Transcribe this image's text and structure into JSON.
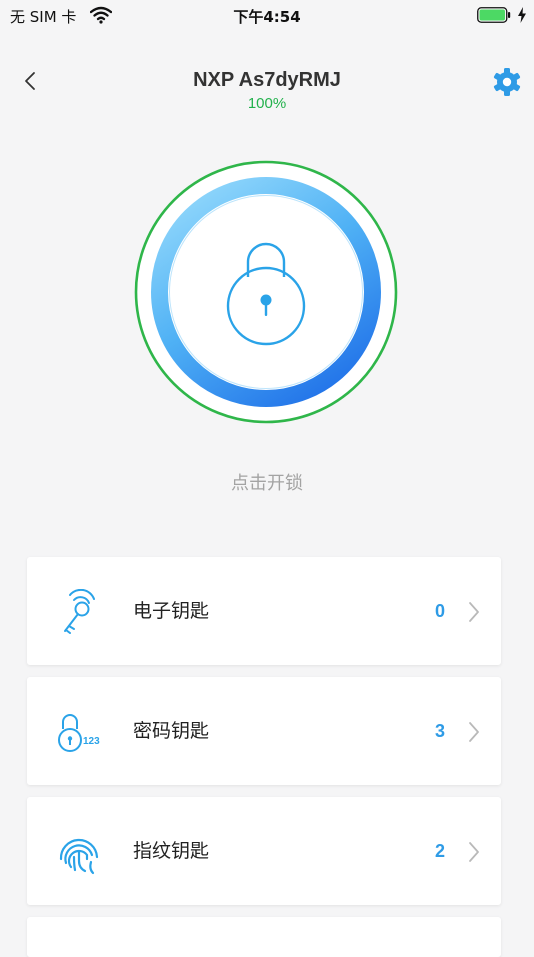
{
  "status_bar": {
    "carrier": "无 SIM 卡",
    "time": "下午4:54"
  },
  "header": {
    "title": "NXP As7dyRMJ",
    "battery_percent": "100%"
  },
  "lock": {
    "hint": "点击开锁"
  },
  "keys": [
    {
      "label": "电子钥匙",
      "count": "0",
      "icon": "e-key-icon"
    },
    {
      "label": "密码钥匙",
      "count": "3",
      "icon": "password-lock-icon"
    },
    {
      "label": "指纹钥匙",
      "count": "2",
      "icon": "fingerprint-icon"
    }
  ],
  "icon_text": {
    "password_digits": "123"
  },
  "colors": {
    "accent_blue": "#2e9be6",
    "ring_green": "#22b14c",
    "battery_green": "#4cd964",
    "hint_gray": "#a3a3a3"
  }
}
